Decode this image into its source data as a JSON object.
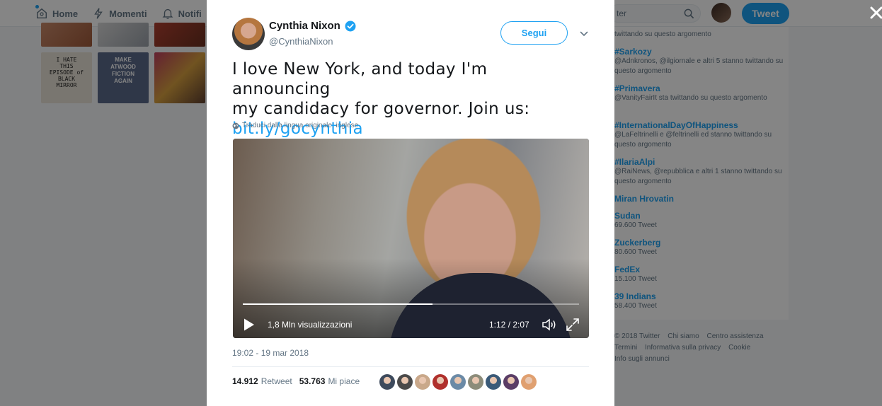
{
  "background": {
    "nav": {
      "items": [
        {
          "label": "Home",
          "icon": "home-icon"
        },
        {
          "label": "Momenti",
          "icon": "lightning-icon"
        },
        {
          "label": "Notifi",
          "icon": "bell-icon"
        }
      ]
    },
    "search": {
      "value": "ter"
    },
    "tweet_button": {
      "label": "Tweet"
    },
    "trends": [
      {
        "name": "",
        "desc": "twittando su questo argomento"
      },
      {
        "name": "#Sarkozy",
        "desc": "@Adnkronos, @ilgiornale e altri 5 stanno twittando su questo argomento"
      },
      {
        "name": "#Primavera",
        "desc": "@VanityFairIt sta twittando su questo argomento"
      },
      {
        "name": "#InternationalDayOfHappiness",
        "desc": "@LaFeltrinelli e @feltrinelli ed stanno twittando su questo argomento"
      },
      {
        "name": "#IlariaAlpi",
        "desc": "@RaiNews, @repubblica e altri 1 stanno twittando su questo argomento"
      },
      {
        "name": "Miran Hrovatin",
        "desc": ""
      },
      {
        "name": "Sudan",
        "desc": "69.600 Tweet"
      },
      {
        "name": "Zuckerberg",
        "desc": "80.600 Tweet"
      },
      {
        "name": "FedEx",
        "desc": "15.100 Tweet"
      },
      {
        "name": "39 Indians",
        "desc": "58.400 Tweet"
      }
    ],
    "footer": {
      "line1": [
        "© 2018 Twitter",
        "Chi siamo",
        "Centro assistenza"
      ],
      "line2": [
        "Termini",
        "Informativa sulla privacy",
        "Cookie"
      ],
      "line3": [
        "Info sugli annunci"
      ]
    },
    "photo_signs": [
      "I HATE THIS EPISODE of BLACK MIRROR",
      "MAKE ATWOOD FICTION AGAIN"
    ]
  },
  "tweet": {
    "author": {
      "name": "Cynthia Nixon",
      "handle": "@CynthiaNixon",
      "verified": true
    },
    "follow_label": "Segui",
    "text_lines": [
      "I love New York, and today I'm announcing",
      "my candidacy for governor. Join us:"
    ],
    "link": "bit.ly/gocynthia",
    "translate": "Traduci dalla lingua originale: inglese",
    "video": {
      "views": "1,8 Mln visualizzazioni",
      "time": "1:12 / 2:07",
      "progress": 0.565
    },
    "timestamp": "19:02 - 19 mar 2018",
    "retweets": {
      "count": "14.912",
      "label": "Retweet"
    },
    "likes": {
      "count": "53.763",
      "label": "Mi piace"
    },
    "liker_colors": [
      "#3d4a5c",
      "#4a4a4a",
      "#c9a88a",
      "#b0302c",
      "#6b8aa6",
      "#8c8c7a",
      "#3a5a78",
      "#5a3d66",
      "#e0a070"
    ]
  },
  "colors": {
    "accent": "#1da1f2",
    "text": "#14171a",
    "muted": "#657786"
  }
}
